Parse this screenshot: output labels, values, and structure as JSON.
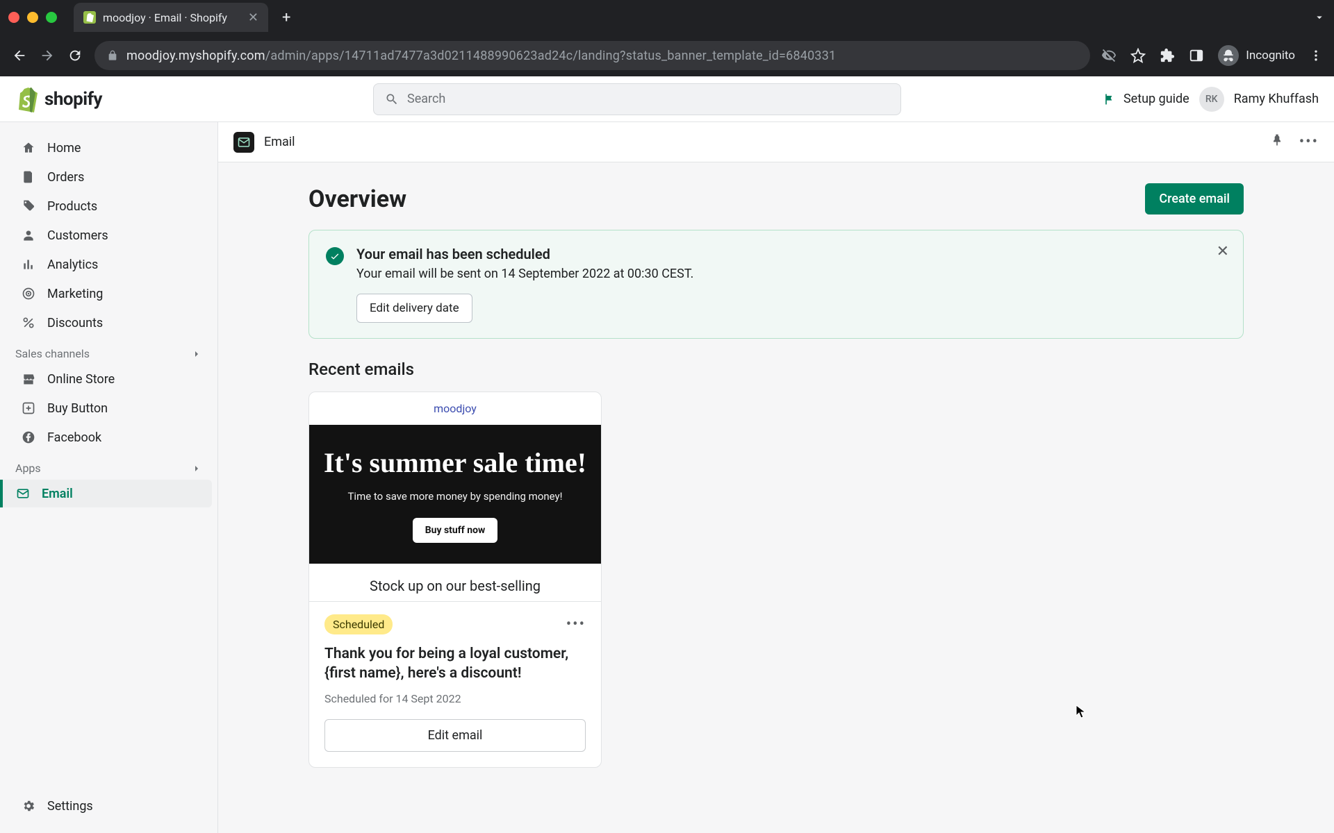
{
  "browser": {
    "tab_title": "moodjoy · Email · Shopify",
    "url_host": "moodjoy.myshopify.com",
    "url_path": "/admin/apps/14711ad7477a3d0211488990623ad24c/landing?status_banner_template_id=6840331",
    "incognito": "Incognito"
  },
  "shopify": {
    "logo_text": "shopify",
    "search_placeholder": "Search",
    "setup_guide": "Setup guide",
    "user_initials": "RK",
    "user_name": "Ramy Khuffash"
  },
  "sidebar": {
    "items": [
      {
        "label": "Home"
      },
      {
        "label": "Orders"
      },
      {
        "label": "Products"
      },
      {
        "label": "Customers"
      },
      {
        "label": "Analytics"
      },
      {
        "label": "Marketing"
      },
      {
        "label": "Discounts"
      }
    ],
    "sales_channels_label": "Sales channels",
    "channels": [
      {
        "label": "Online Store"
      },
      {
        "label": "Buy Button"
      },
      {
        "label": "Facebook"
      }
    ],
    "apps_label": "Apps",
    "apps": [
      {
        "label": "Email"
      }
    ],
    "settings": "Settings"
  },
  "app_header": {
    "name": "Email"
  },
  "page": {
    "title": "Overview",
    "create_label": "Create email"
  },
  "banner": {
    "title": "Your email has been scheduled",
    "text": "Your email will be sent on 14 September 2022 at 00:30 CEST.",
    "button": "Edit delivery date"
  },
  "recent": {
    "title": "Recent emails"
  },
  "card": {
    "store": "moodjoy",
    "hero_title": "It's summer sale time!",
    "hero_text": "Time to save more money by spending money!",
    "hero_cta": "Buy stuff now",
    "sub_text": "Stock up on our best-selling",
    "badge": "Scheduled",
    "subject": "Thank you for being a loyal customer, {first name}, here's a discount!",
    "schedule_text": "Scheduled for 14 Sept 2022",
    "edit_label": "Edit email"
  }
}
